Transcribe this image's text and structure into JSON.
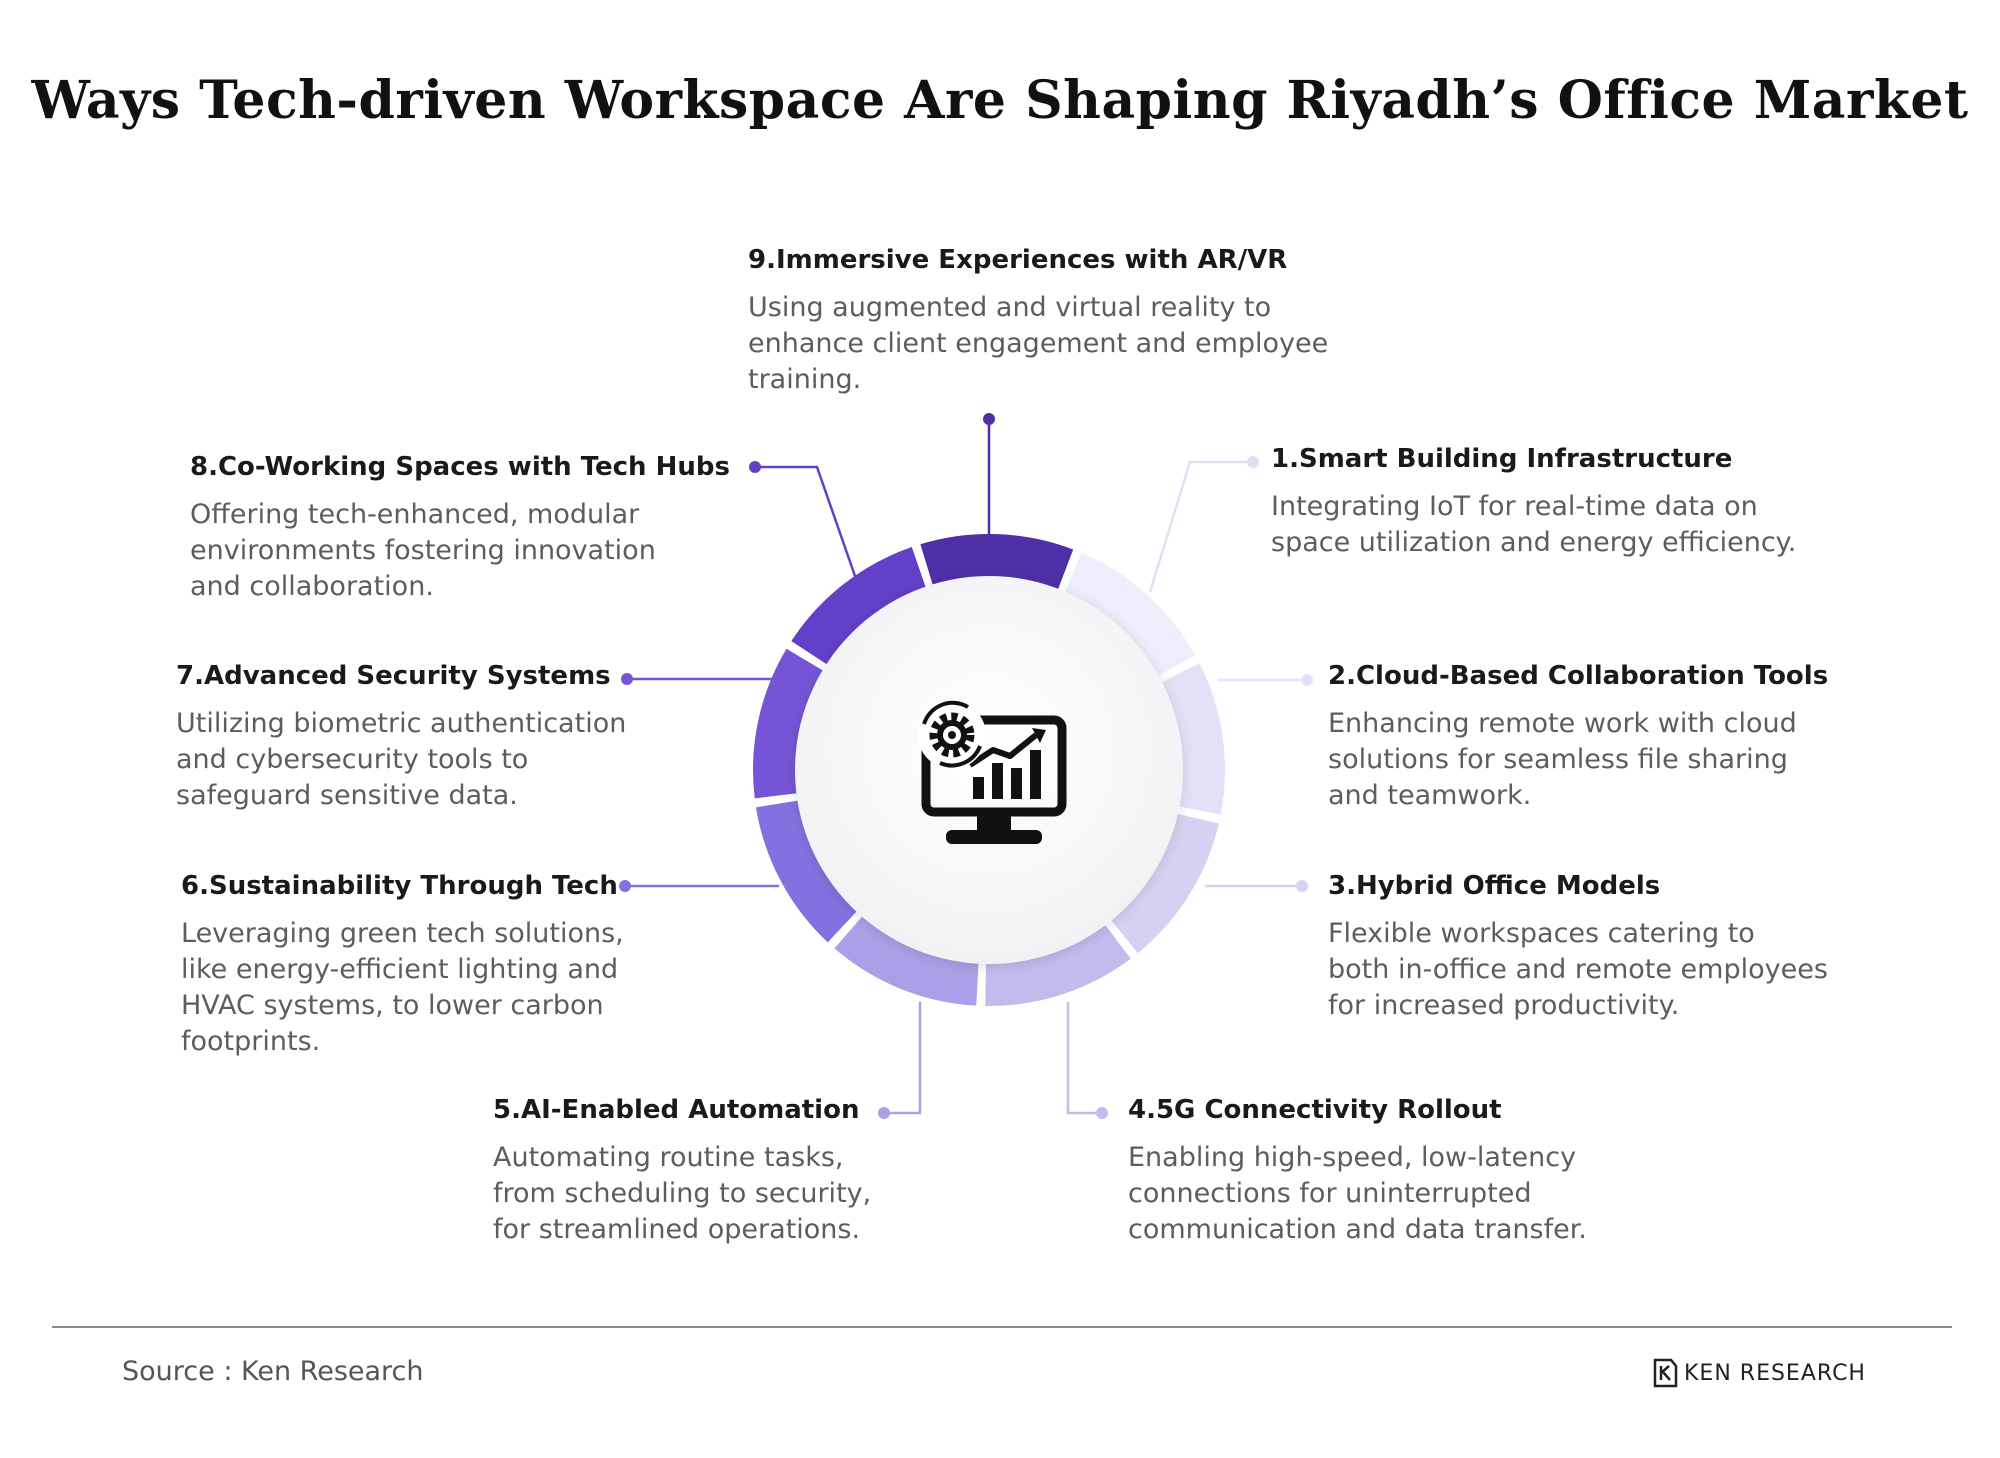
{
  "title": "Ways Tech-driven Workspace Are Shaping Riyadh’s Office Market",
  "items": [
    {
      "title": "1.Smart Building Infrastructure",
      "description": "Integrating IoT for real-time data on\nspace utilization and energy efficiency.",
      "color": "#eeedfb"
    },
    {
      "title": "2.Cloud-Based Collaboration Tools",
      "description": "Enhancing remote work with cloud\nsolutions for seamless file sharing\nand teamwork.",
      "color": "#e3e1f7"
    },
    {
      "title": "3.Hybrid Office Models",
      "description": "Flexible workspaces catering to\nboth in-office and remote employees\nfor increased productivity.",
      "color": "#d5d1f3"
    },
    {
      "title": "4.5G Connectivity Rollout",
      "description": "Enabling high-speed, low-latency\nconnections for uninterrupted\ncommunication and data transfer.",
      "color": "#c2bbee"
    },
    {
      "title": "5.AI-Enabled Automation",
      "description": "Automating routine tasks,\nfrom scheduling to security,\nfor streamlined operations.",
      "color": "#aaa0e7"
    },
    {
      "title": "6.Sustainability Through Tech",
      "description": "Leveraging green tech solutions,\nlike energy-efficient lighting and\nHVAC systems, to lower carbon\nfootprints.",
      "color": "#8272df"
    },
    {
      "title": "7.Advanced Security Systems",
      "description": "Utilizing biometric authentication\nand cybersecurity tools to\nsafeguard sensitive data.",
      "color": "#7555d6"
    },
    {
      "title": "8.Co-Working Spaces with Tech Hubs",
      "description": "Offering tech-enhanced, modular\nenvironments fostering innovation\nand collaboration.",
      "color": "#6240c8"
    },
    {
      "title": "9.Immersive Experiences with AR/VR",
      "description": "Using augmented and virtual reality to\nenhance client engagement and employee\ntraining.",
      "color": "#4e30a6"
    }
  ],
  "center_icon": "computer-analytics-gear-icon",
  "footer": {
    "source": "Source : Ken Research",
    "brand_name": "KEN RESEARCH",
    "brand_logo": "ken-research-logo"
  }
}
